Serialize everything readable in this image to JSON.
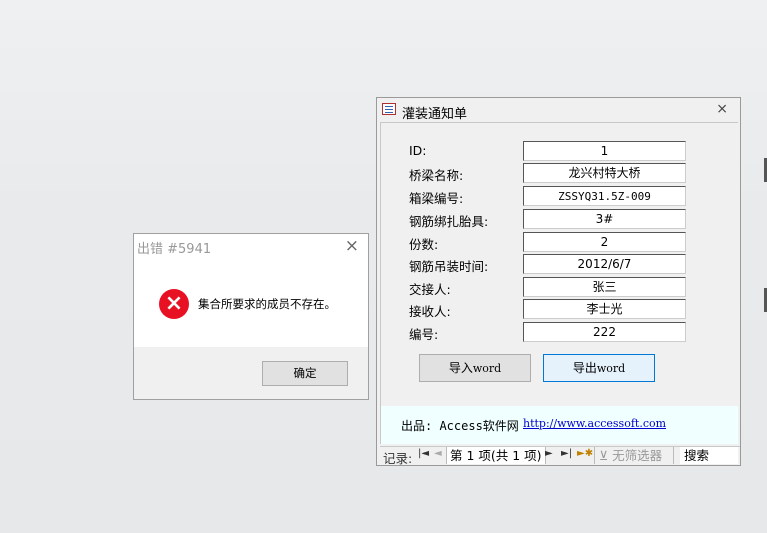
{
  "form": {
    "title": "灌装通知单",
    "fields": [
      {
        "label": "ID:",
        "value": "1"
      },
      {
        "label": "桥梁名称:",
        "value": "龙兴村特大桥"
      },
      {
        "label": "箱梁编号:",
        "value": "ZSSYQ31.5Z-009"
      },
      {
        "label": "钢筋绑扎胎具:",
        "value": "3#"
      },
      {
        "label": "份数:",
        "value": "2"
      },
      {
        "label": "钢筋吊装时间:",
        "value": "2012/6/7"
      },
      {
        "label": "交接人:",
        "value": "张三"
      },
      {
        "label": "接收人:",
        "value": "李士光"
      },
      {
        "label": "编号:",
        "value": "222"
      }
    ],
    "buttons": {
      "import_prefix": "导入",
      "import_word": "word",
      "export_prefix": "导出",
      "export_word": "word"
    },
    "footer": {
      "producer": "出品: Access软件网",
      "link": "http://www.accessoft.com"
    },
    "nav": {
      "record_label": "记录:",
      "position": "第 1 项(共 1 项)",
      "filter": "无筛选器",
      "search": "搜索"
    }
  },
  "error_dialog": {
    "title": "出错 #5941",
    "message": "集合所要求的成员不存在。",
    "ok_label": "确定",
    "icon": "error-x-icon",
    "icon_color": "#e81123"
  }
}
